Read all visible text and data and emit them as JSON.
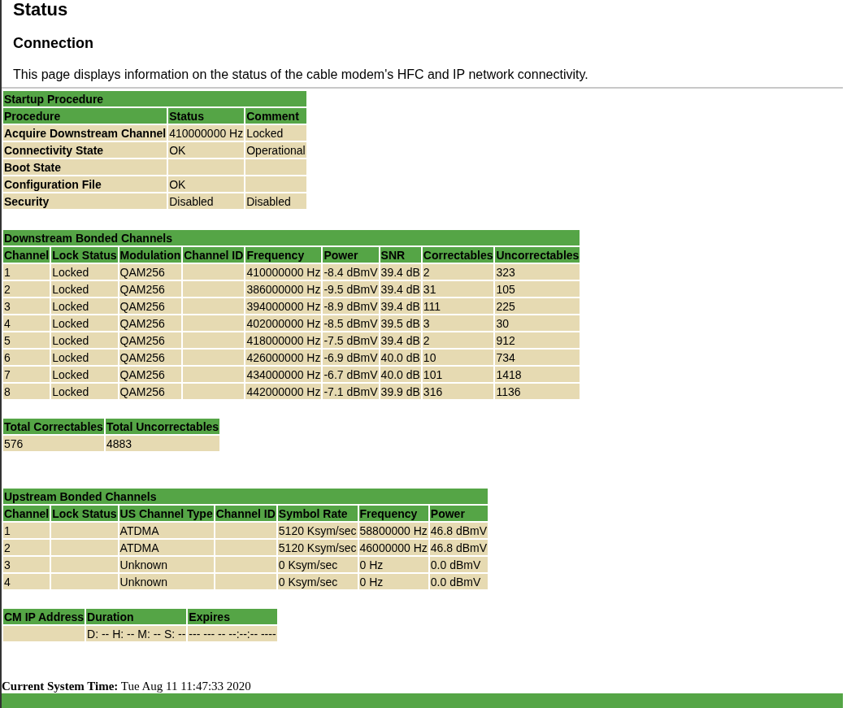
{
  "page_title": "Status",
  "section_title": "Connection",
  "description": "This page displays information on the status of the cable modem's HFC and IP network connectivity.",
  "tables": [
    {
      "title": "Startup Procedure",
      "bold_first_column": true,
      "columns": [
        "Procedure",
        "Status",
        "Comment"
      ],
      "rows": [
        [
          "Acquire Downstream Channel",
          "410000000 Hz",
          "Locked"
        ],
        [
          "Connectivity State",
          "OK",
          "Operational"
        ],
        [
          "Boot State",
          "",
          ""
        ],
        [
          "Configuration File",
          "OK",
          ""
        ],
        [
          "Security",
          "Disabled",
          "Disabled"
        ]
      ]
    },
    {
      "title": "Downstream Bonded Channels",
      "columns": [
        "Channel",
        "Lock Status",
        "Modulation",
        "Channel ID",
        "Frequency",
        "Power",
        "SNR",
        "Correctables",
        "Uncorrectables"
      ],
      "rows": [
        [
          "1",
          "Locked",
          "QAM256",
          "",
          "410000000 Hz",
          "-8.4 dBmV",
          "39.4 dB",
          "2",
          "323"
        ],
        [
          "2",
          "Locked",
          "QAM256",
          "",
          "386000000 Hz",
          "-9.5 dBmV",
          "39.4 dB",
          "31",
          "105"
        ],
        [
          "3",
          "Locked",
          "QAM256",
          "",
          "394000000 Hz",
          "-8.9 dBmV",
          "39.4 dB",
          "111",
          "225"
        ],
        [
          "4",
          "Locked",
          "QAM256",
          "",
          "402000000 Hz",
          "-8.5 dBmV",
          "39.5 dB",
          "3",
          "30"
        ],
        [
          "5",
          "Locked",
          "QAM256",
          "",
          "418000000 Hz",
          "-7.5 dBmV",
          "39.4 dB",
          "2",
          "912"
        ],
        [
          "6",
          "Locked",
          "QAM256",
          "",
          "426000000 Hz",
          "-6.9 dBmV",
          "40.0 dB",
          "10",
          "734"
        ],
        [
          "7",
          "Locked",
          "QAM256",
          "",
          "434000000 Hz",
          "-6.7 dBmV",
          "40.0 dB",
          "101",
          "1418"
        ],
        [
          "8",
          "Locked",
          "QAM256",
          "",
          "442000000 Hz",
          "-7.1 dBmV",
          "39.9 dB",
          "316",
          "1136"
        ]
      ]
    },
    {
      "columns": [
        "Total Correctables",
        "Total Uncorrectables"
      ],
      "rows": [
        [
          "576",
          "4883"
        ]
      ]
    },
    {
      "title": "Upstream Bonded Channels",
      "columns": [
        "Channel",
        "Lock Status",
        "US Channel Type",
        "Channel ID",
        "Symbol Rate",
        "Frequency",
        "Power"
      ],
      "rows": [
        [
          "1",
          "",
          "ATDMA",
          "",
          "5120 Ksym/sec",
          "58800000 Hz",
          "46.8 dBmV"
        ],
        [
          "2",
          "",
          "ATDMA",
          "",
          "5120 Ksym/sec",
          "46000000 Hz",
          "46.8 dBmV"
        ],
        [
          "3",
          "",
          "Unknown",
          "",
          "0 Ksym/sec",
          "0 Hz",
          "0.0 dBmV"
        ],
        [
          "4",
          "",
          "Unknown",
          "",
          "0 Ksym/sec",
          "0 Hz",
          "0.0 dBmV"
        ]
      ]
    },
    {
      "columns": [
        "CM IP Address",
        "Duration",
        "Expires"
      ],
      "rows": [
        [
          "",
          "D: -- H: -- M: -- S: --",
          "--- --- -- --:--:-- ----"
        ]
      ]
    }
  ],
  "system_time": {
    "label": "Current System Time:",
    "value": "Tue Aug 11 11:47:33 2020"
  }
}
